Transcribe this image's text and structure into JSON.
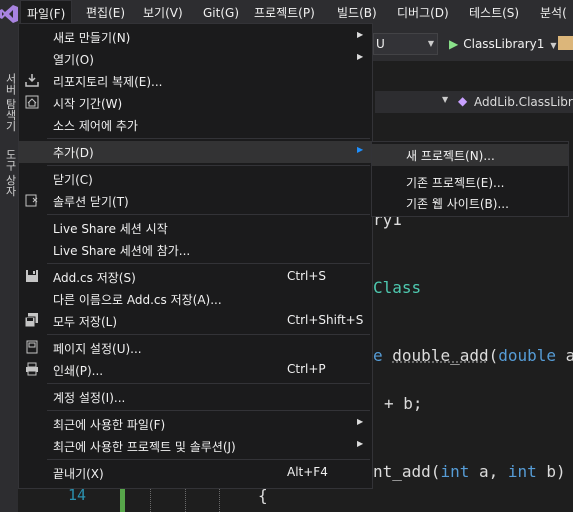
{
  "menubar": {
    "items": [
      "파일(F)",
      "편집(E)",
      "보기(V)",
      "Git(G)",
      "프로젝트(P)",
      "빌드(B)",
      "디버그(D)",
      "테스트(S)",
      "분석("
    ]
  },
  "toolbar": {
    "config_value": "U",
    "run_target": "ClassLibrary1"
  },
  "side_tabs": {
    "tab1": "서버 탐색기",
    "tab2": "도구 상자"
  },
  "nav": {
    "member": "AddLib.ClassLibrar"
  },
  "editor": {
    "line_number": "14",
    "frag_ry": "ry1",
    "frag_class": "Class",
    "frag_e": "e",
    "frag_method": "double_add",
    "frag_paren": "(",
    "frag_double": "double",
    "frag_a": " a",
    "frag_plus_b": "+ b;",
    "frag_nt_add": "nt_add(",
    "frag_int1": "int",
    "frag_a2": " a, ",
    "frag_int2": "int",
    "frag_b": " b)",
    "frag_brace": "{"
  },
  "file_menu": {
    "new": "새로 만들기(N)",
    "open": "열기(O)",
    "clone": "리포지토리 복제(E)...",
    "start": "시작 기간(W)",
    "add_source": "소스 제어에 추가",
    "add": "추가(D)",
    "close": "닫기(C)",
    "close_solution": "솔루션 닫기(T)",
    "live_share_start": "Live Share 세션 시작",
    "live_share_join": "Live Share 세션에 참가...",
    "save": "Add.cs 저장(S)",
    "save_shortcut": "Ctrl+S",
    "save_as": "다른 이름으로 Add.cs 저장(A)...",
    "save_all": "모두 저장(L)",
    "save_all_shortcut": "Ctrl+Shift+S",
    "page_setup": "페이지 설정(U)...",
    "print": "인쇄(P)...",
    "print_shortcut": "Ctrl+P",
    "account": "계정 설정(I)...",
    "recent_files": "최근에 사용한 파일(F)",
    "recent_projects": "최근에 사용한 프로젝트 및 솔루션(J)",
    "exit": "끝내기(X)",
    "exit_shortcut": "Alt+F4"
  },
  "add_submenu": {
    "new_project": "새 프로젝트(N)...",
    "existing_project": "기존 프로젝트(E)...",
    "existing_website": "기존 웹 사이트(B)..."
  },
  "colors": {
    "menu_bg": "#1b1b1c",
    "highlight": "#333334",
    "keyword": "#569cd6",
    "type": "#4ec9b0"
  }
}
